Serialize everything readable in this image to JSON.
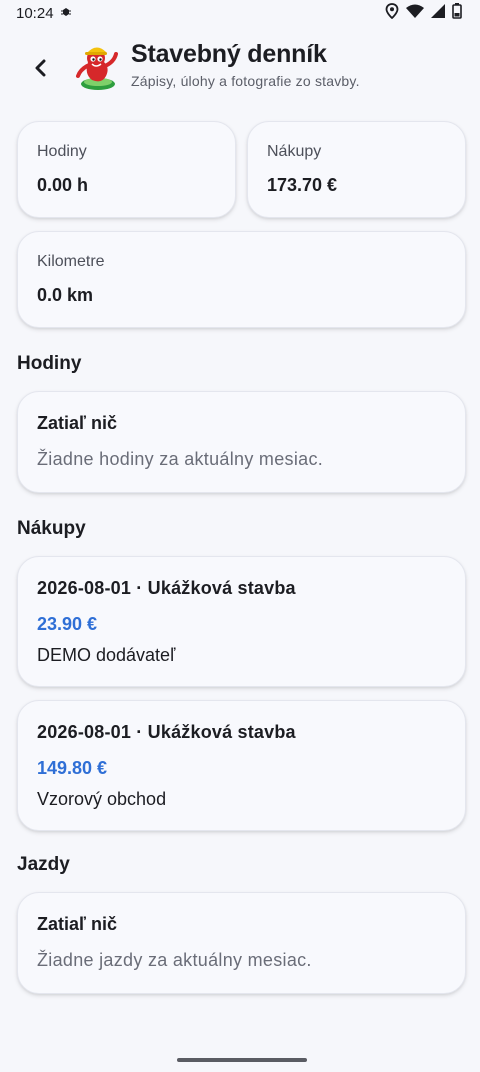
{
  "status_bar": {
    "time": "10:24"
  },
  "header": {
    "title": "Stavebný denník",
    "subtitle": "Zápisy, úlohy a fotografie zo stavby."
  },
  "stats": [
    {
      "label": "Hodiny",
      "value": "0.00 h"
    },
    {
      "label": "Nákupy",
      "value": "173.70 €"
    },
    {
      "label": "Kilometre",
      "value": "0.0 km"
    }
  ],
  "sections": {
    "hours": {
      "title": "Hodiny",
      "empty_title": "Zatiaľ nič",
      "empty_text": "Žiadne hodiny za aktuálny mesiac."
    },
    "purchases": {
      "title": "Nákupy",
      "items": [
        {
          "header": "2026-08-01 · Ukážková stavba",
          "amount": "23.90 €",
          "vendor": "DEMO dodávateľ"
        },
        {
          "header": "2026-08-01 · Ukážková stavba",
          "amount": "149.80 €",
          "vendor": "Vzorový obchod"
        }
      ]
    },
    "rides": {
      "title": "Jazdy",
      "empty_title": "Zatiaľ nič",
      "empty_text": "Žiadne jazdy za aktuálny mesiac."
    }
  },
  "colors": {
    "accent": "#2f6fd6",
    "background": "#f6f7fb",
    "card": "#f8f9fd"
  },
  "icons": [
    "bug-icon",
    "location-icon",
    "wifi-icon",
    "signal-icon",
    "battery-icon",
    "back-arrow-icon",
    "app-logo-icon"
  ]
}
